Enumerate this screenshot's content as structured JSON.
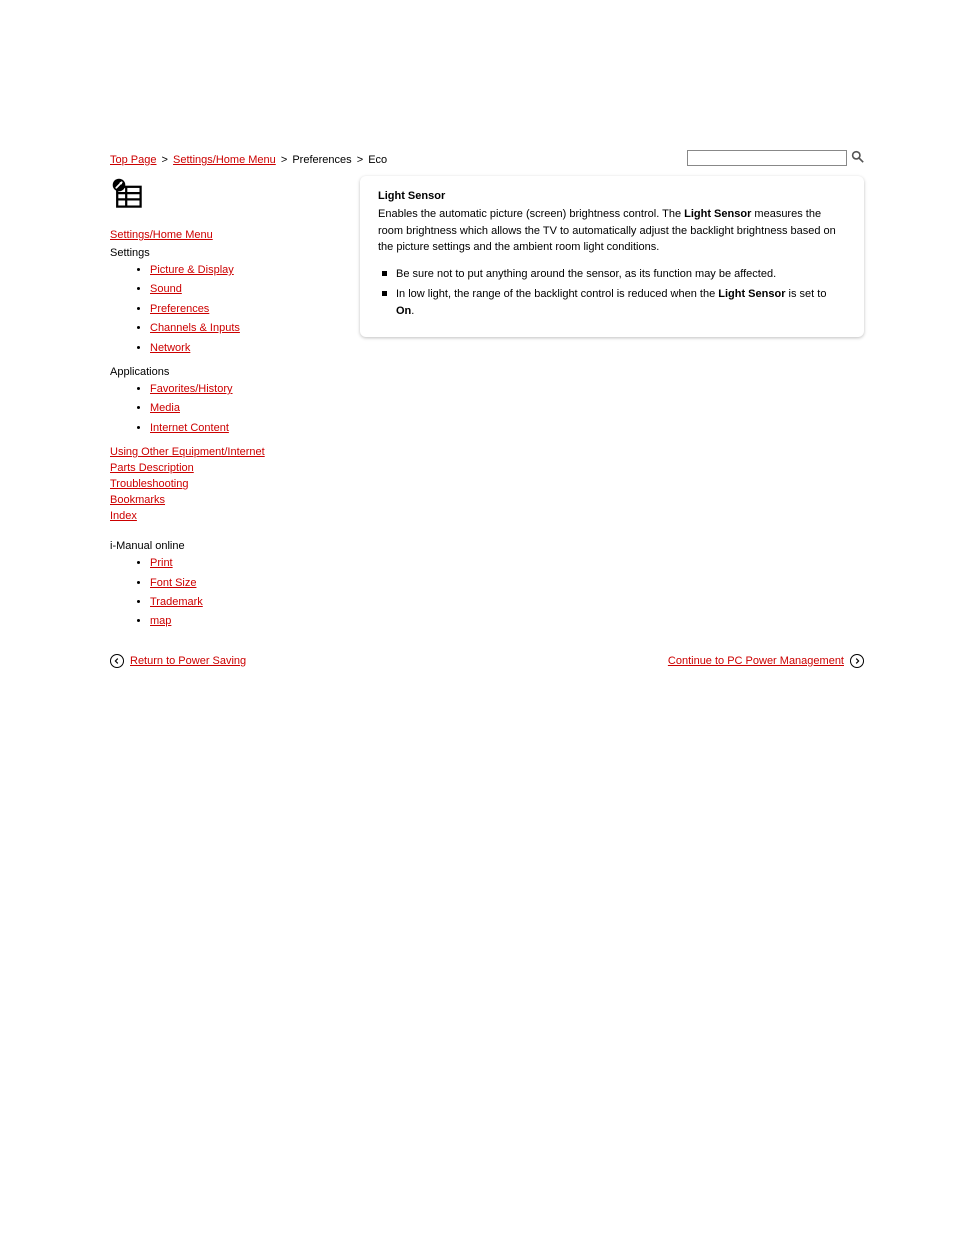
{
  "breadcrumb": {
    "item1": "Top Page",
    "sep": ">",
    "item2": "Settings/Home Menu",
    "sep2": ">",
    "item3_plain": "Preferences",
    "sep3": ">",
    "item4_plain": "Eco"
  },
  "search": {
    "placeholder": ""
  },
  "nav": {
    "section1": {
      "title": "Settings/Home Menu",
      "sub": "Settings",
      "items": [
        "Picture & Display",
        "Sound",
        "Preferences",
        "Channels & Inputs",
        "Network"
      ]
    },
    "section2": {
      "sub": "Applications",
      "items": [
        "Favorites/History",
        "Media",
        "Internet Content"
      ]
    },
    "top_links": {
      "t1": "Using Other Equipment/Internet",
      "t2": "Parts Description",
      "t3": "Troubleshooting",
      "t4": "Bookmarks",
      "t5": "Index"
    },
    "manual_links": {
      "sub": "i-Manual online",
      "items": [
        "Print",
        "Font Size",
        "Trademark",
        "map"
      ]
    }
  },
  "content": {
    "title": "Light Sensor",
    "body_pre": "Enables the automatic picture (screen) brightness control. The ",
    "body_bold1": "Light Sensor",
    "body_mid": " measures the room brightness which allows the TV to automatically adjust the backlight brightness based on the picture settings and the ambient room light conditions.",
    "note1": "Be sure not to put anything around the sensor, as its function may be affected.",
    "note2_pre": "In low light, the range of the backlight control is reduced when the ",
    "note2_bold": "Light Sensor",
    "note2_mid": " is set to ",
    "note2_bold2": "On",
    "note2_post": "."
  },
  "footer": {
    "prev": "Return to Power Saving",
    "next": "Continue to PC Power Management"
  }
}
